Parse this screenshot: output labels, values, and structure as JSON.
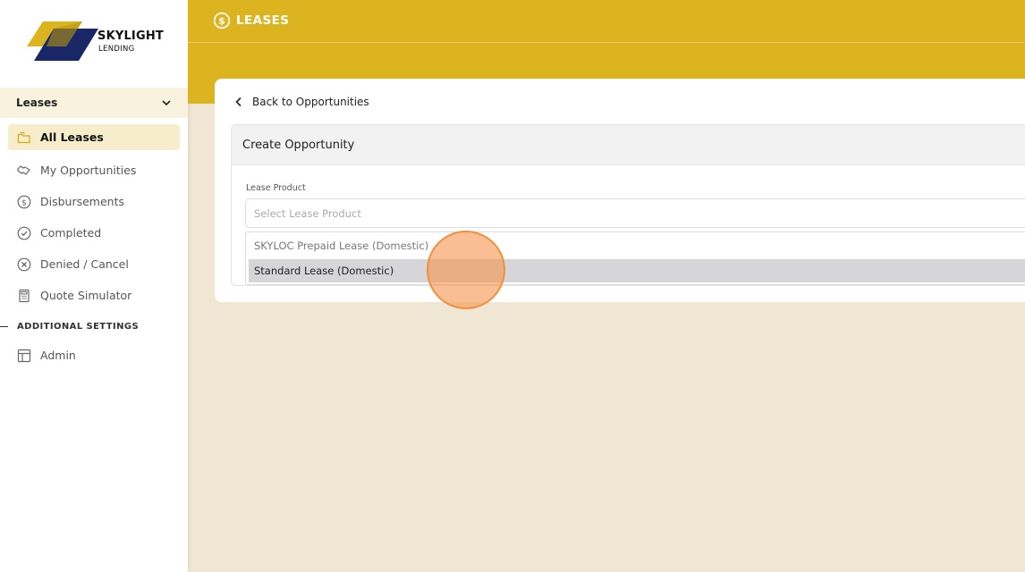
{
  "brand": {
    "name": "SKYLIGHT",
    "sub": "LENDING",
    "colors": {
      "gold": "#dcb41f",
      "navy": "#1a2766"
    }
  },
  "sidebar": {
    "section_label": "Leases",
    "items": [
      {
        "label": "All Leases",
        "icon": "folder-icon",
        "active": true
      },
      {
        "label": "My Opportunities",
        "icon": "handshake-icon"
      },
      {
        "label": "Disbursements",
        "icon": "dollar-circle-icon"
      },
      {
        "label": "Completed",
        "icon": "check-circle-icon"
      },
      {
        "label": "Denied / Cancel",
        "icon": "x-circle-icon"
      },
      {
        "label": "Quote Simulator",
        "icon": "calculator-icon"
      }
    ],
    "settings_label": "ADDITIONAL SETTINGS",
    "admin": {
      "label": "Admin",
      "icon": "layout-icon"
    }
  },
  "header": {
    "title": "LEASES",
    "icon": "dollar-circle-icon"
  },
  "main": {
    "back_label": "Back to Opportunities",
    "panel_title": "Create Opportunity",
    "field_label": "Lease Product",
    "select_placeholder": "Select Lease Product",
    "options": [
      "SKYLOC Prepaid Lease (Domestic)",
      "Standard Lease (Domestic)"
    ],
    "highlighted_option": "Standard Lease (Domestic)"
  }
}
